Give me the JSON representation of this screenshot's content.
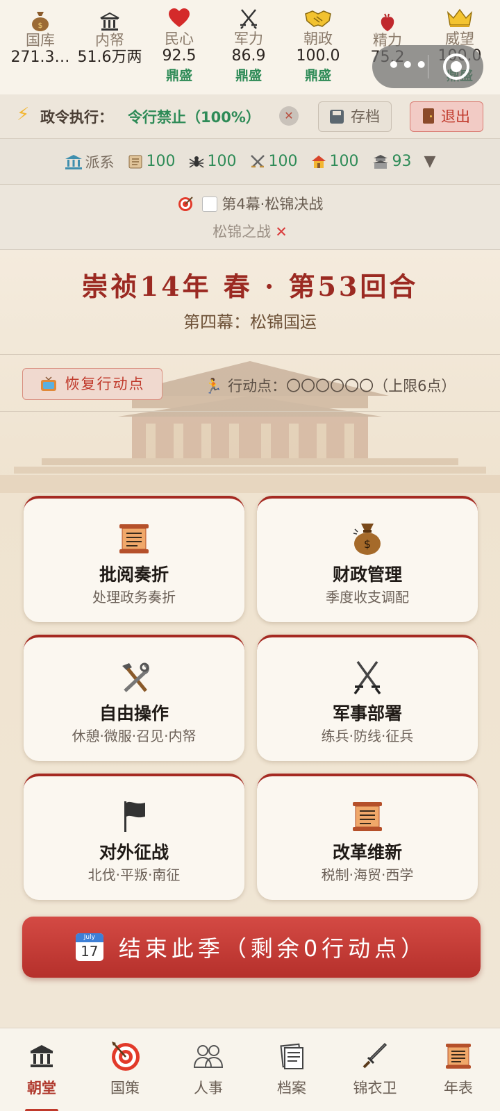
{
  "stats": [
    {
      "label": "国库",
      "value": "271.3…",
      "level": "",
      "icon": "money-bag-icon"
    },
    {
      "label": "内帑",
      "value": "51.6万两",
      "level": "",
      "icon": "treasury-building-icon"
    },
    {
      "label": "民心",
      "value": "92.5",
      "level": "鼎盛",
      "icon": "heart-icon"
    },
    {
      "label": "军力",
      "value": "86.9",
      "level": "鼎盛",
      "icon": "crossed-swords-icon"
    },
    {
      "label": "朝政",
      "value": "100.0",
      "level": "鼎盛",
      "icon": "handshake-icon"
    },
    {
      "label": "精力",
      "value": "75.2",
      "level": "",
      "icon": "anatomical-heart-icon"
    },
    {
      "label": "威望",
      "value": "100.0",
      "level": "鼎盛",
      "icon": "crown-icon"
    }
  ],
  "decree": {
    "label": "政令执行：",
    "value": "令行禁止（100%）",
    "save_label": "存档",
    "exit_label": "退出"
  },
  "faction": {
    "title": "派系",
    "items": [
      {
        "icon": "scroll-icon",
        "value": "100"
      },
      {
        "icon": "spider-icon",
        "value": "100"
      },
      {
        "icon": "crossed-swords-icon",
        "value": "100"
      },
      {
        "icon": "house-icon",
        "value": "100"
      },
      {
        "icon": "temple-icon",
        "value": "93"
      }
    ]
  },
  "act": {
    "title": "第4幕·松锦决战",
    "battle": "松锦之战"
  },
  "era": {
    "title": "崇祯14年 春 · 第53回合",
    "chapter": "第四幕：松锦国运"
  },
  "action": {
    "restore_label": "恢复行动点",
    "points_text": "行动点：〇〇〇〇〇〇（上限6点）"
  },
  "cards": [
    {
      "title": "批阅奏折",
      "sub": "处理政务奏折",
      "icon": "scroll-icon"
    },
    {
      "title": "财政管理",
      "sub": "季度收支调配",
      "icon": "money-bag-icon"
    },
    {
      "title": "自由操作",
      "sub": "休憩·微服·召见·内帑",
      "icon": "hammer-wrench-icon"
    },
    {
      "title": "军事部署",
      "sub": "练兵·防线·征兵",
      "icon": "crossed-swords-icon"
    },
    {
      "title": "对外征战",
      "sub": "北伐·平叛·南征",
      "icon": "black-flag-icon"
    },
    {
      "title": "改革维新",
      "sub": "税制·海贸·西学",
      "icon": "scroll-icon"
    }
  ],
  "end_button": "结束此季（剩余0行动点）",
  "nav": [
    {
      "label": "朝堂",
      "icon": "classical-building-icon",
      "active": true
    },
    {
      "label": "国策",
      "icon": "target-icon",
      "active": false
    },
    {
      "label": "人事",
      "icon": "people-icon",
      "active": false
    },
    {
      "label": "档案",
      "icon": "documents-icon",
      "active": false
    },
    {
      "label": "锦衣卫",
      "icon": "dagger-icon",
      "active": false
    },
    {
      "label": "年表",
      "icon": "scroll-icon",
      "active": false
    }
  ],
  "colors": {
    "accent_red": "#b5302b",
    "good_green": "#2e8b57",
    "background": "#f3ece0"
  }
}
